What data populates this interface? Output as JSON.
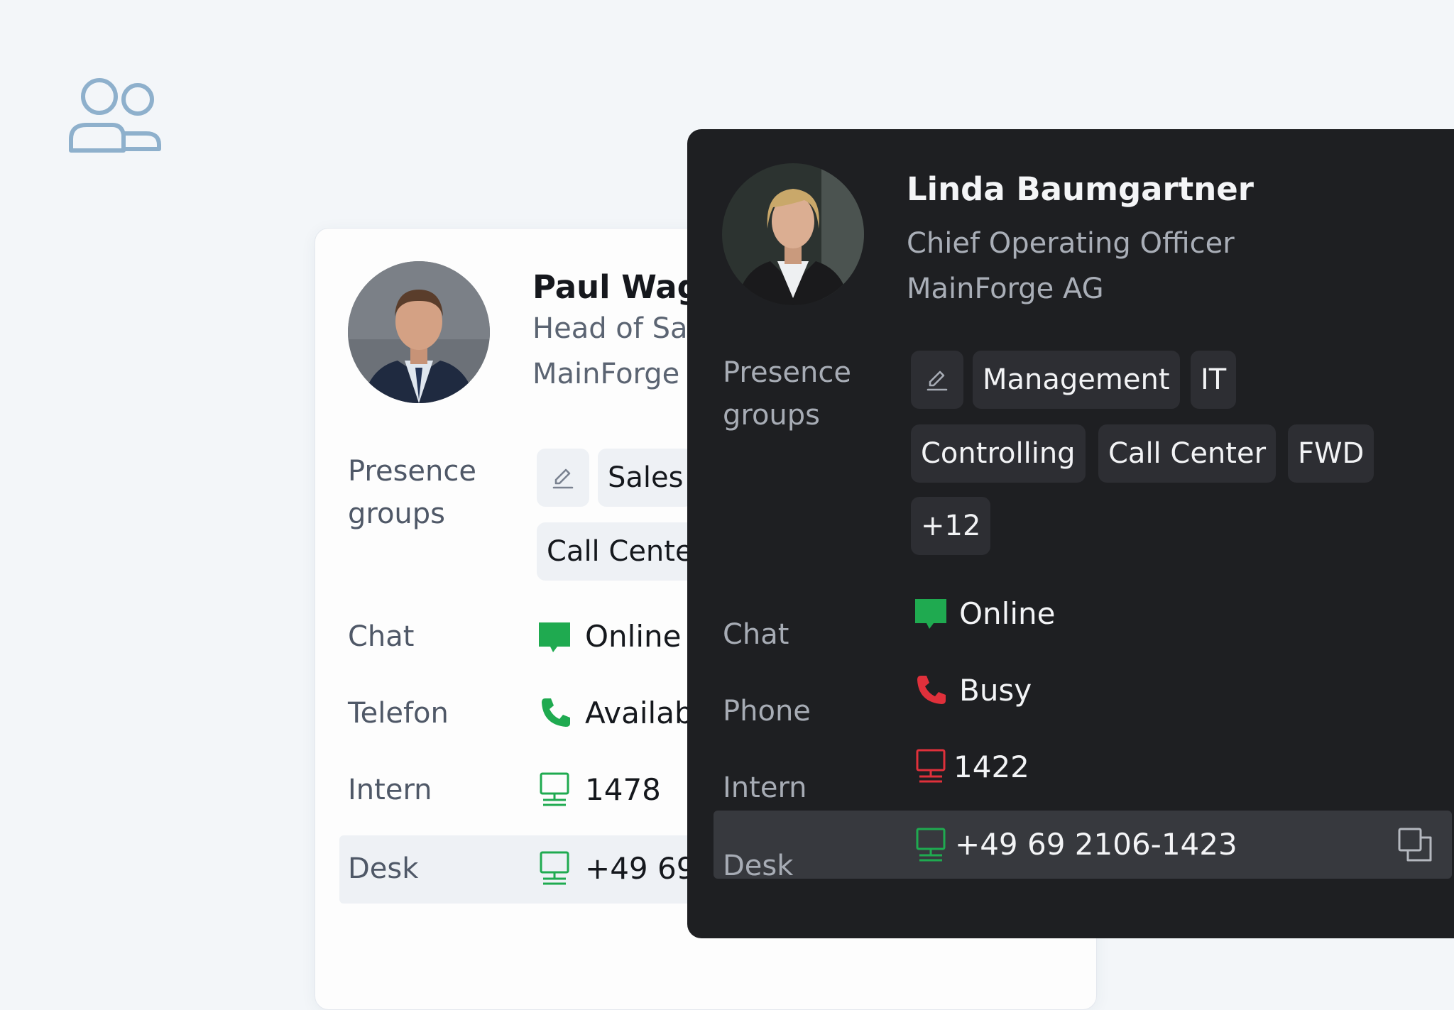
{
  "colors": {
    "page_bg": "#f3f6f9",
    "accent_icon": "#8eb0cc",
    "status_green": "#1faa50",
    "status_red": "#e0303b",
    "dark_card_bg": "#1e1f22",
    "light_card_bg": "#fdfdfd"
  },
  "page_icon": "users-icon",
  "contact_light": {
    "name": "Paul Wag",
    "title": "Head of Sa",
    "company": "MainForge",
    "presence_label_line1": "Presence",
    "presence_label_line2": "groups",
    "groups": [
      "Sales",
      "Call Cente"
    ],
    "chat": {
      "label": "Chat",
      "status": "Online",
      "icon": "chat-bubble-icon"
    },
    "phone": {
      "label": "Telefon",
      "status": "Availab",
      "icon": "phone-icon"
    },
    "intern": {
      "label": "Intern",
      "number": "1478",
      "icon": "desk-phone-icon"
    },
    "desk": {
      "label": "Desk",
      "number": "+49 69",
      "icon": "desk-phone-icon"
    }
  },
  "contact_dark": {
    "name": "Linda Baumgartner",
    "title": "Chief Operating Officer",
    "company": "MainForge AG",
    "presence_label_line1": "Presence",
    "presence_label_line2": "groups",
    "groups": [
      "Management",
      "IT",
      "Controlling",
      "Call Center",
      "FWD",
      "+12"
    ],
    "chat": {
      "label": "Chat",
      "status": "Online",
      "icon": "chat-bubble-icon"
    },
    "phone": {
      "label": "Phone",
      "status": "Busy",
      "icon": "phone-icon"
    },
    "intern": {
      "label": "Intern",
      "number": "1422",
      "icon": "desk-phone-icon"
    },
    "desk": {
      "label": "Desk",
      "number": "+49 69 2106-1423",
      "icon": "desk-phone-icon"
    }
  }
}
